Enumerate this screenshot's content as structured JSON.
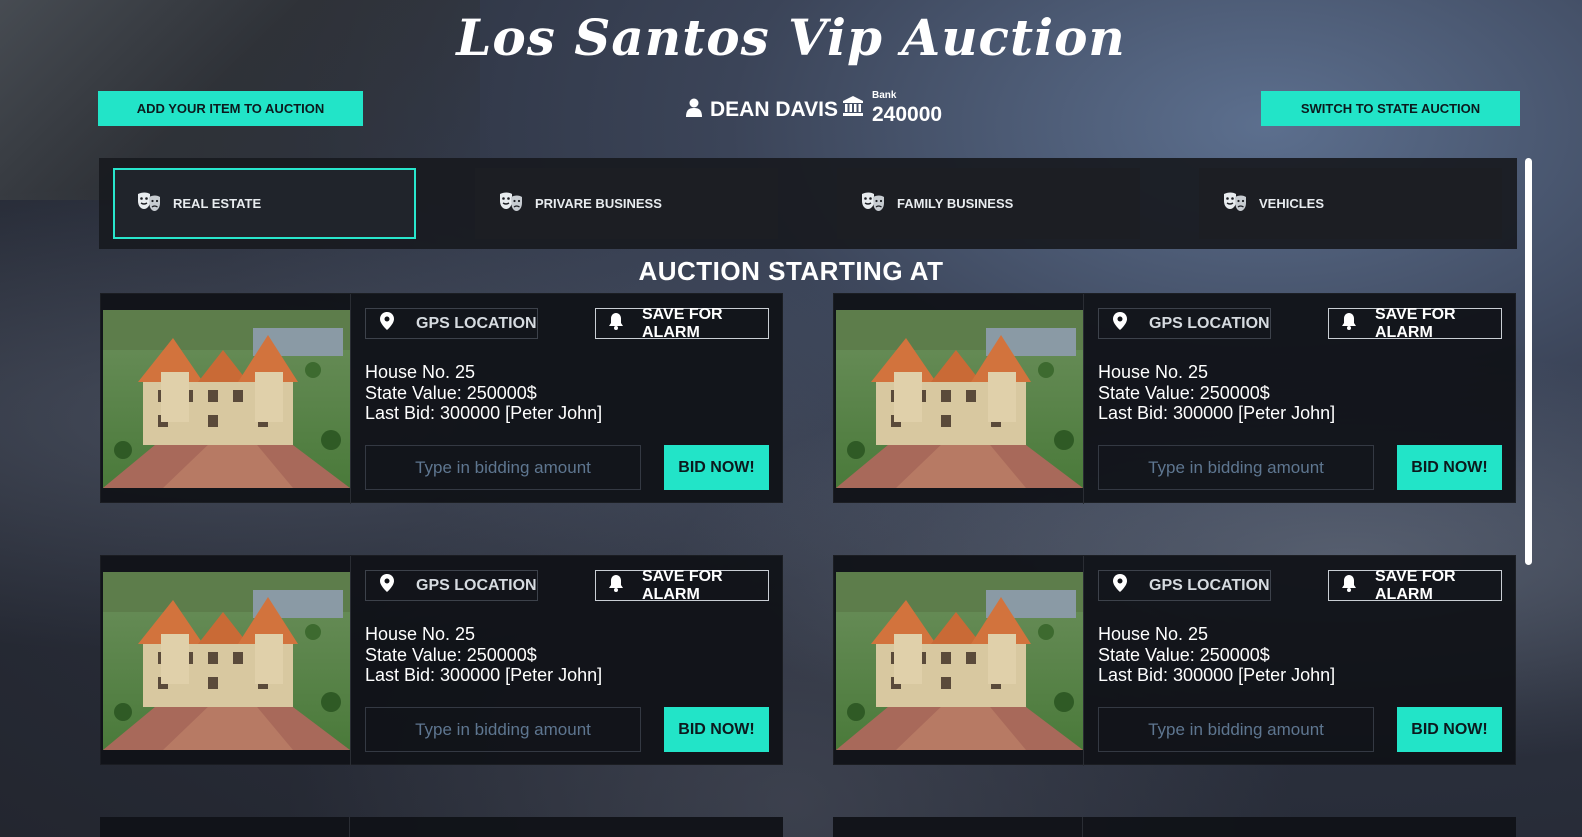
{
  "header": {
    "title": "Los Santos Vip Auction",
    "add_item_label": "ADD YOUR ITEM TO AUCTION",
    "switch_label": "SWITCH TO STATE AUCTION",
    "user_name": "DEAN DAVIS",
    "bank_label": "Bank",
    "bank_value": "240000"
  },
  "tabs": [
    {
      "label": "REAL ESTATE",
      "icon": "theater-masks-icon",
      "active": true
    },
    {
      "label": "PRIVARE BUSINESS",
      "icon": "theater-masks-icon",
      "active": false
    },
    {
      "label": "FAMILY BUSINESS",
      "icon": "theater-masks-icon",
      "active": false
    },
    {
      "label": "VEHICLES",
      "icon": "theater-masks-icon",
      "active": false
    }
  ],
  "section_title": "AUCTION STARTING AT",
  "cards": [
    {
      "gps_label": "GPS LOCATION",
      "alarm_label": "SAVE FOR ALARM",
      "house": "House No. 25",
      "state_value": "State Value: 250000$",
      "last_bid": "Last Bid: 300000 [Peter John]",
      "input_placeholder": "Type in bidding amount",
      "bid_label": "BID NOW!"
    },
    {
      "gps_label": "GPS LOCATION",
      "alarm_label": "SAVE FOR ALARM",
      "house": "House No. 25",
      "state_value": "State Value: 250000$",
      "last_bid": "Last Bid: 300000 [Peter John]",
      "input_placeholder": "Type in bidding amount",
      "bid_label": "BID NOW!"
    },
    {
      "gps_label": "GPS LOCATION",
      "alarm_label": "SAVE FOR ALARM",
      "house": "House No. 25",
      "state_value": "State Value: 250000$",
      "last_bid": "Last Bid: 300000 [Peter John]",
      "input_placeholder": "Type in bidding amount",
      "bid_label": "BID NOW!"
    },
    {
      "gps_label": "GPS LOCATION",
      "alarm_label": "SAVE FOR ALARM",
      "house": "House No. 25",
      "state_value": "State Value: 250000$",
      "last_bid": "Last Bid: 300000 [Peter John]",
      "input_placeholder": "Type in bidding amount",
      "bid_label": "BID NOW!"
    }
  ],
  "colors": {
    "accent": "#22e4c8",
    "panel": "#101217"
  },
  "icons": {
    "user": "user-icon",
    "bank": "bank-building-icon",
    "gps": "map-pin-icon",
    "alarm": "bell-icon"
  }
}
